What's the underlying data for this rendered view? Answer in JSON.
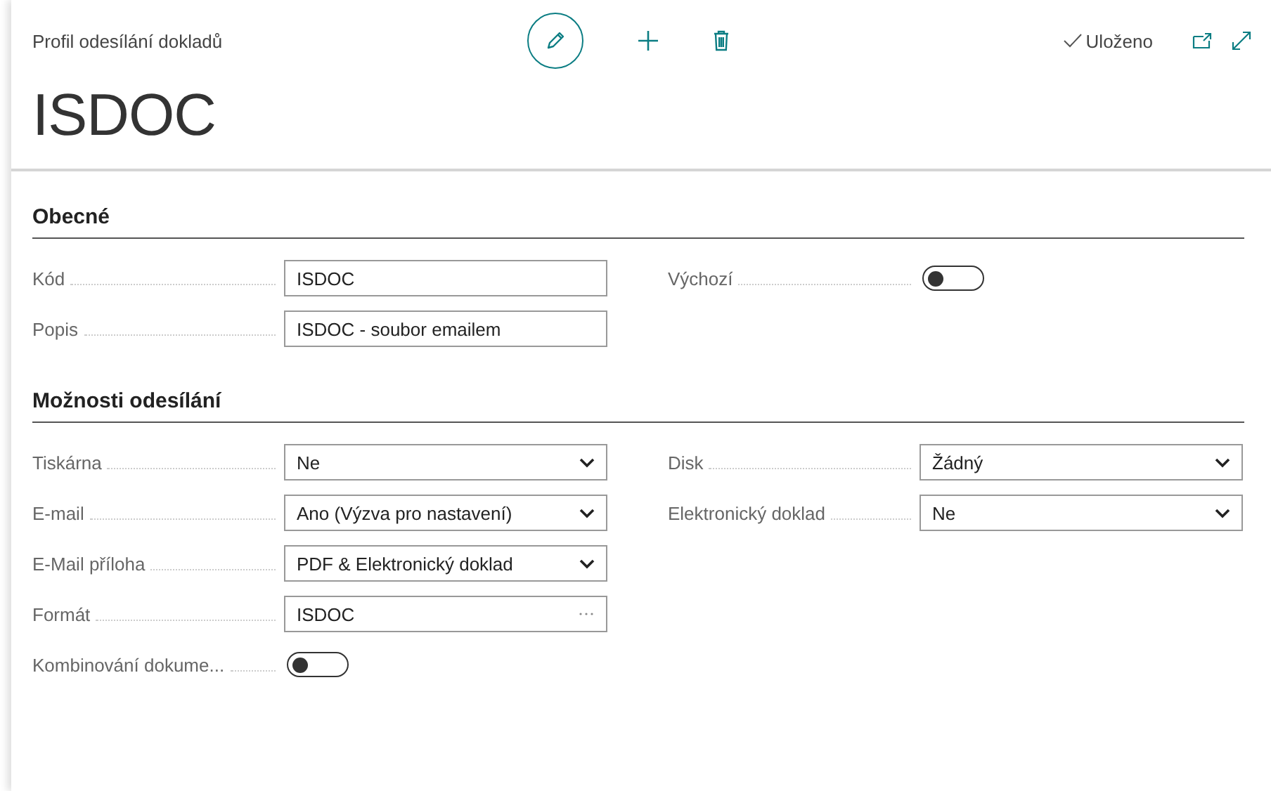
{
  "header": {
    "caption": "Profil odesílání dokladů",
    "title": "ISDOC",
    "status": "Uloženo"
  },
  "sections": [
    {
      "title": "Obecné",
      "left": [
        {
          "label": "Kód",
          "kind": "text",
          "value": "ISDOC"
        },
        {
          "label": "Popis",
          "kind": "text",
          "value": "ISDOC - soubor emailem"
        }
      ],
      "right": [
        {
          "label": "Výchozí",
          "kind": "toggle",
          "on": false
        }
      ]
    },
    {
      "title": "Možnosti odesílání",
      "left": [
        {
          "label": "Tiskárna",
          "kind": "select",
          "value": "Ne"
        },
        {
          "label": "E-mail",
          "kind": "select",
          "value": "Ano (Výzva pro nastavení)"
        },
        {
          "label": "E-Mail příloha",
          "kind": "select",
          "value": "PDF & Elektronický doklad"
        },
        {
          "label": "Formát",
          "kind": "lookup",
          "value": "ISDOC"
        },
        {
          "label": "Kombinování dokume...",
          "kind": "toggle",
          "on": false
        }
      ],
      "right": [
        {
          "label": "Disk",
          "kind": "select",
          "value": "Žádný"
        },
        {
          "label": "Elektronický doklad",
          "kind": "select",
          "value": "Ne"
        }
      ]
    }
  ]
}
